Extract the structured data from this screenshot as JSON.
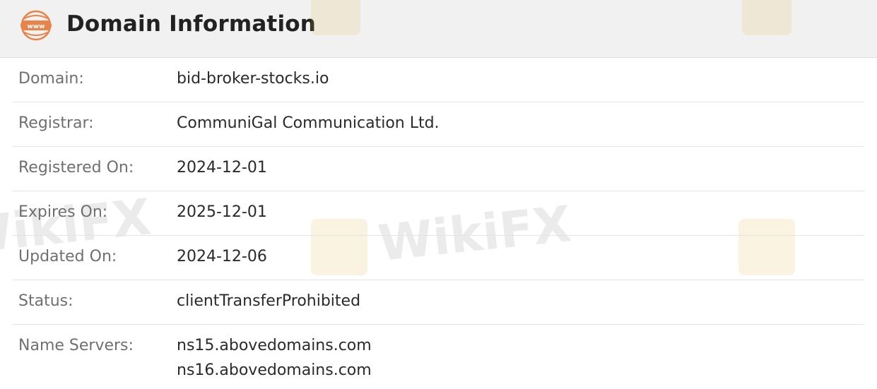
{
  "header": {
    "title": "Domain Information",
    "icon": "www-globe-icon",
    "icon_color": "#e8834a"
  },
  "watermark": {
    "text": "WikiFX"
  },
  "rows": [
    {
      "label": "Domain:",
      "value": "bid-broker-stocks.io"
    },
    {
      "label": "Registrar:",
      "value": "CommuniGal Communication Ltd."
    },
    {
      "label": "Registered On:",
      "value": "2024-12-01"
    },
    {
      "label": "Expires On:",
      "value": "2025-12-01"
    },
    {
      "label": "Updated On:",
      "value": "2024-12-06"
    },
    {
      "label": "Status:",
      "value": "clientTransferProhibited"
    }
  ],
  "name_servers": {
    "label": "Name Servers:",
    "values": [
      "ns15.abovedomains.com",
      "ns16.abovedomains.com"
    ]
  }
}
